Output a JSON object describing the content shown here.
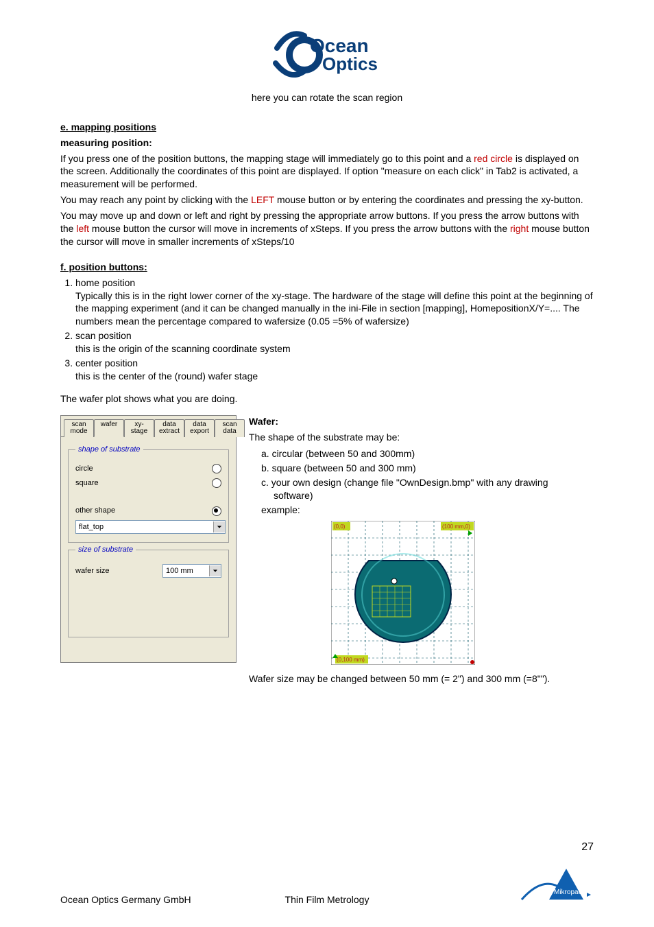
{
  "logo": {
    "line1": "Ocean",
    "line2": "Optics"
  },
  "caption": "here you can rotate the scan region",
  "section_e": {
    "heading": "e. mapping positions",
    "subheading": "measuring position:",
    "p1a": "If you press one of the position buttons, the mapping stage will immediately go to this point and a ",
    "p1_red": "red circle",
    "p1b": " is displayed on the screen. Additionally the coordinates of this point are displayed. If option \"measure on each click\" in Tab2 is activated, a measurement will be performed.",
    "p2a": "You may reach any point by clicking with the ",
    "p2_red": "LEFT",
    "p2b": " mouse button or by entering the coordinates and pressing the xy-button.",
    "p3a": "You may move up and down or left and right by pressing the appropriate arrow buttons. If you press the arrow buttons with the ",
    "p3_red1": "left",
    "p3b": " mouse button the cursor will move in increments of xSteps. If you press the arrow buttons with the ",
    "p3_red2": "right",
    "p3c": " mouse button the cursor will move in smaller increments of xSteps/10"
  },
  "section_f": {
    "heading": "f. position buttons:",
    "items": [
      {
        "title": "home position",
        "desc": "Typically this is in the right lower corner of the xy-stage. The hardware of the stage will define this point at the beginning of the mapping experiment (and it can be changed manually in the ini-File in section [mapping], HomepositionX/Y=.... The numbers mean the percentage compared to wafersize (0.05 =5% of wafersize)"
      },
      {
        "title": "scan position",
        "desc": "this is the origin of the scanning coordinate system"
      },
      {
        "title": "center position",
        "desc": "this is the center of the (round) wafer stage"
      }
    ],
    "tail": "The wafer plot shows what you are doing."
  },
  "dialog": {
    "tabs": [
      "scan mode",
      "wafer",
      "xy-stage",
      "data extract",
      "data export",
      "scan data"
    ],
    "active_tab": 1,
    "group_shape_title": "shape of substrate",
    "radio_circle": "circle",
    "radio_square": "square",
    "radio_other": "other shape",
    "other_select_value": "flat_top",
    "group_size_title": "size of substrate",
    "size_label": "wafer size",
    "size_value": "100 mm"
  },
  "wafer": {
    "heading": "Wafer:",
    "intro": "The shape of the substrate may be:",
    "a": "a. circular (between 50 and 300mm)",
    "b": "b. square (between 50 and 300 mm)",
    "c_line1": "c. your own design (change file \"OwnDesign.bmp\" with any drawing",
    "c_line2": "software)",
    "example": "example:",
    "diagram": {
      "tl": "(0,0)",
      "tr": "(100 mm,0)",
      "bl": "(0,100 mm)"
    },
    "footer": "Wafer size may be changed between 50 mm  (= 2\") and 300 mm (=8\"\")."
  },
  "page_number": "27",
  "footer_left": "Ocean Optics Germany GmbH",
  "footer_right": "Thin Film Metrology",
  "mikropack": "Mikropack"
}
